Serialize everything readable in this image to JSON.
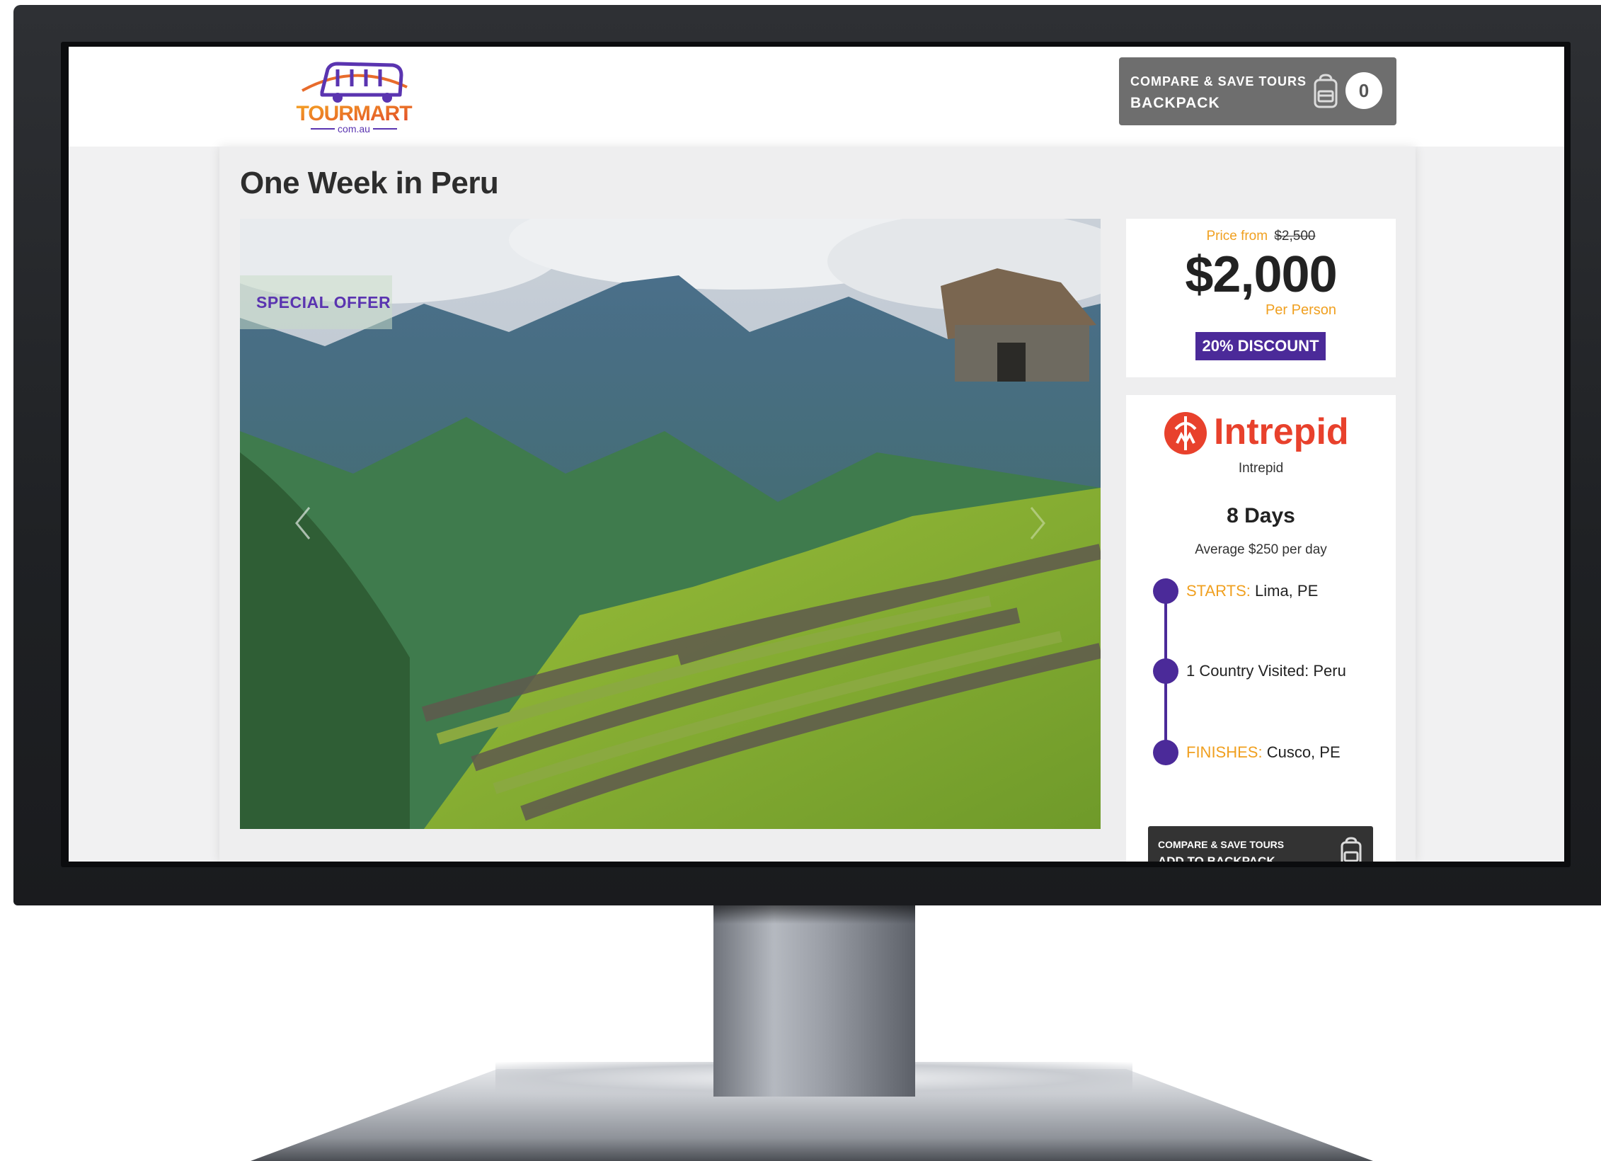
{
  "header": {
    "logo_text": "TOURMART",
    "logo_subtext": "com.au",
    "backpack": {
      "line1": "COMPARE & SAVE TOURS",
      "line2": "BACKPACK",
      "icon": "backpack-icon",
      "count": "0"
    }
  },
  "tour": {
    "title": "One Week in Peru",
    "badge": "SPECIAL OFFER"
  },
  "pricing": {
    "from_label": "Price from",
    "original_price": "$2,500",
    "price": "$2,000",
    "unit": "Per Person",
    "discount": "20% DISCOUNT"
  },
  "details": {
    "operator_logo_text": "Intrepid",
    "operator_name": "Intrepid",
    "duration": "8 Days",
    "average": "Average $250 per day",
    "starts_label": "STARTS:",
    "starts_value": "Lima, PE",
    "countries": "1 Country Visited: Peru",
    "finishes_label": "FINISHES:",
    "finishes_value": "Cusco, PE"
  },
  "add_to_backpack": {
    "line1": "COMPARE & SAVE TOURS",
    "line2": "ADD TO BACKPACK"
  },
  "colors": {
    "brand_purple": "#4b2a99",
    "accent_orange": "#f0a020",
    "intrepid_red": "#e8412c",
    "button_grey": "#6e6e6e"
  }
}
